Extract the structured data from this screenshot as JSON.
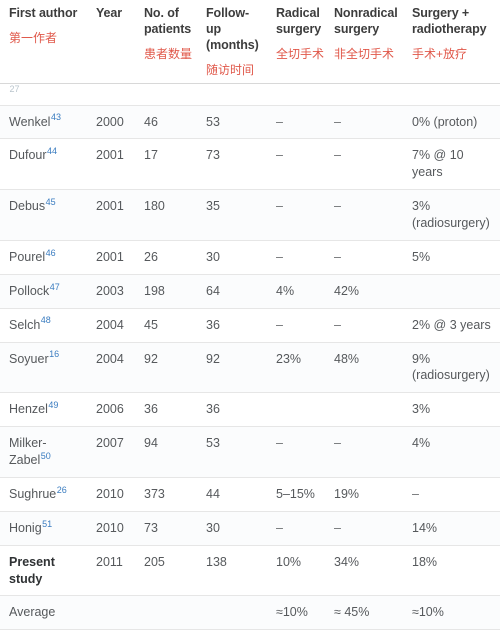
{
  "table": {
    "caption_visible": false,
    "columns": [
      {
        "key": "author",
        "en": "First author",
        "zh": "第一作者"
      },
      {
        "key": "year",
        "en": "Year",
        "zh": ""
      },
      {
        "key": "patients",
        "en": "No. of patients",
        "zh": "患者数量"
      },
      {
        "key": "followup",
        "en": "Follow-up (months)",
        "zh": "随访时间"
      },
      {
        "key": "radical",
        "en": "Radical surgery",
        "zh": "全切手术"
      },
      {
        "key": "nonrad",
        "en": "Nonradical surgery",
        "zh": "非全切手术"
      },
      {
        "key": "surgrt",
        "en": "Surgery + radiotherapy",
        "zh": "手术+放疗"
      }
    ],
    "header_lines": {
      "author": [
        "First author"
      ],
      "year": [
        "Year"
      ],
      "patients": [
        "No. of",
        "patients"
      ],
      "followup": [
        "Follow-",
        "up",
        "(months)"
      ],
      "radical": [
        "Radical",
        "surgery"
      ],
      "nonrad": [
        "Nonradical",
        "surgery"
      ],
      "surgrt": [
        "Surgery +",
        "radiotherapy"
      ]
    },
    "rows": [
      {
        "id": "ghost-row",
        "ghost": true,
        "author": "",
        "ref": "27",
        "year": "",
        "patients": "",
        "followup": "",
        "radical": "",
        "nonrad": "",
        "surgrt": ""
      },
      {
        "id": "wenkel",
        "author": "Wenkel",
        "ref": "43",
        "year": "2000",
        "patients": "46",
        "followup": "53",
        "radical": "–",
        "nonrad": "–",
        "surgrt": "0% (proton)"
      },
      {
        "id": "dufour",
        "author": "Dufour",
        "ref": "44",
        "year": "2001",
        "patients": "17",
        "followup": "73",
        "radical": "–",
        "nonrad": "–",
        "surgrt": "7% @ 10 years"
      },
      {
        "id": "debus",
        "author": "Debus",
        "ref": "45",
        "year": "2001",
        "patients": "180",
        "followup": "35",
        "radical": "–",
        "nonrad": "–",
        "surgrt": "3% (radiosurgery)"
      },
      {
        "id": "pourel",
        "author": "Pourel",
        "ref": "46",
        "year": "2001",
        "patients": "26",
        "followup": "30",
        "radical": "–",
        "nonrad": "–",
        "surgrt": "5%"
      },
      {
        "id": "pollock",
        "author": "Pollock",
        "ref": "47",
        "year": "2003",
        "patients": "198",
        "followup": "64",
        "radical": "4%",
        "nonrad": "42%",
        "surgrt": ""
      },
      {
        "id": "selch",
        "author": "Selch",
        "ref": "48",
        "year": "2004",
        "patients": "45",
        "followup": "36",
        "radical": "–",
        "nonrad": "–",
        "surgrt": "2% @ 3 years"
      },
      {
        "id": "soyuer",
        "author": "Soyuer",
        "ref": "16",
        "year": "2004",
        "patients": "92",
        "followup": "92",
        "radical": "23%",
        "nonrad": "48%",
        "surgrt": "9% (radiosurgery)"
      },
      {
        "id": "henzel",
        "author": "Henzel",
        "ref": "49",
        "year": "2006",
        "patients": "36",
        "followup": "36",
        "radical": "",
        "nonrad": "",
        "surgrt": "3%"
      },
      {
        "id": "milker-zabel",
        "author": "Milker-Zabel",
        "ref": "50",
        "year": "2007",
        "patients": "94",
        "followup": "53",
        "radical": "–",
        "nonrad": "–",
        "surgrt": "4%"
      },
      {
        "id": "sughrue",
        "author": "Sughrue",
        "ref": "26",
        "year": "2010",
        "patients": "373",
        "followup": "44",
        "radical": "5–15%",
        "nonrad": "19%",
        "surgrt": "–"
      },
      {
        "id": "honig",
        "author": "Honig",
        "ref": "51",
        "year": "2010",
        "patients": "73",
        "followup": "30",
        "radical": "–",
        "nonrad": "–",
        "surgrt": "14%"
      },
      {
        "id": "present-study",
        "present": true,
        "author": "Present study",
        "ref": "",
        "year": "2011",
        "patients": "205",
        "followup": "138",
        "radical": "10%",
        "nonrad": "34%",
        "surgrt": "18%"
      },
      {
        "id": "average",
        "average": true,
        "author": "Average",
        "ref": "",
        "year": "",
        "patients": "",
        "followup": "",
        "radical": "≈10%",
        "nonrad": "≈ 45%",
        "surgrt": "≈10%"
      }
    ]
  },
  "colors": {
    "annotation_red": "#e0584a",
    "reference_blue": "#3a7cc0",
    "body_text": "#56595c",
    "header_text": "#3d3d3d",
    "rule": "#e6e6e6",
    "header_rule": "#d8d8d8",
    "row_alt_bg": "#fbfcfd"
  }
}
